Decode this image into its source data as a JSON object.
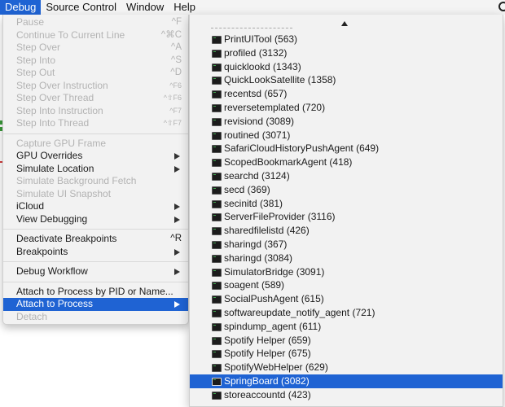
{
  "menubar": {
    "items": [
      {
        "label": "Debug",
        "active": true
      },
      {
        "label": "Source Control",
        "active": false
      },
      {
        "label": "Window",
        "active": false
      },
      {
        "label": "Help",
        "active": false
      }
    ],
    "search_icon": "magnifier-icon"
  },
  "debug_menu": {
    "groups": [
      [
        {
          "label": "Pause",
          "shortcut": "^F",
          "disabled": true
        },
        {
          "label": "Continue To Current Line",
          "shortcut": "^⌘C",
          "disabled": true
        },
        {
          "label": "Step Over",
          "shortcut": "^A",
          "disabled": true
        },
        {
          "label": "Step Into",
          "shortcut": "^S",
          "disabled": true
        },
        {
          "label": "Step Out",
          "shortcut": "^D",
          "disabled": true
        },
        {
          "label": "Step Over Instruction",
          "shortcut": "^F6",
          "disabled": true
        },
        {
          "label": "Step Over Thread",
          "shortcut": "^⇧F6",
          "disabled": true
        },
        {
          "label": "Step Into Instruction",
          "shortcut": "^F7",
          "disabled": true
        },
        {
          "label": "Step Into Thread",
          "shortcut": "^⇧F7",
          "disabled": true
        }
      ],
      [
        {
          "label": "Capture GPU Frame",
          "disabled": true
        },
        {
          "label": "GPU Overrides",
          "submenu": true
        },
        {
          "label": "Simulate Location",
          "submenu": true
        },
        {
          "label": "Simulate Background Fetch",
          "disabled": true
        },
        {
          "label": "Simulate UI Snapshot",
          "disabled": true
        },
        {
          "label": "iCloud",
          "submenu": true
        },
        {
          "label": "View Debugging",
          "submenu": true
        }
      ],
      [
        {
          "label": "Deactivate Breakpoints",
          "shortcut": "^R"
        },
        {
          "label": "Breakpoints",
          "submenu": true
        }
      ],
      [
        {
          "label": "Debug Workflow",
          "submenu": true
        }
      ],
      [
        {
          "label": "Attach to Process by PID or Name..."
        },
        {
          "label": "Attach to Process",
          "submenu": true,
          "highlighted": true
        },
        {
          "label": "Detach",
          "disabled": true
        }
      ]
    ]
  },
  "process_submenu": {
    "scroll_indicator": "scroll-up-arrow",
    "items": [
      {
        "label": "PrintUITool (563)"
      },
      {
        "label": "profiled (3132)"
      },
      {
        "label": "quicklookd (1343)"
      },
      {
        "label": "QuickLookSatellite (1358)"
      },
      {
        "label": "recentsd (657)"
      },
      {
        "label": "reversetemplated (720)"
      },
      {
        "label": "revisiond (3089)"
      },
      {
        "label": "routined (3071)"
      },
      {
        "label": "SafariCloudHistoryPushAgent (649)"
      },
      {
        "label": "ScopedBookmarkAgent (418)"
      },
      {
        "label": "searchd (3124)"
      },
      {
        "label": "secd (369)"
      },
      {
        "label": "secinitd (381)"
      },
      {
        "label": "ServerFileProvider (3116)"
      },
      {
        "label": "sharedfilelistd (426)"
      },
      {
        "label": "sharingd (367)"
      },
      {
        "label": "sharingd (3084)"
      },
      {
        "label": "SimulatorBridge (3091)"
      },
      {
        "label": "soagent (589)"
      },
      {
        "label": "SocialPushAgent (615)"
      },
      {
        "label": "softwareupdate_notify_agent (721)"
      },
      {
        "label": "spindump_agent (611)"
      },
      {
        "label": "Spotify Helper (659)"
      },
      {
        "label": "Spotify Helper (675)"
      },
      {
        "label": "SpotifyWebHelper (629)"
      },
      {
        "label": "SpringBoard (3082)",
        "highlighted": true
      },
      {
        "label": "storeaccountd (423)"
      }
    ]
  },
  "colors": {
    "highlight": "#1f63d3",
    "menu_bg": "#f2f2f2",
    "disabled_text": "#b3b3b3"
  }
}
